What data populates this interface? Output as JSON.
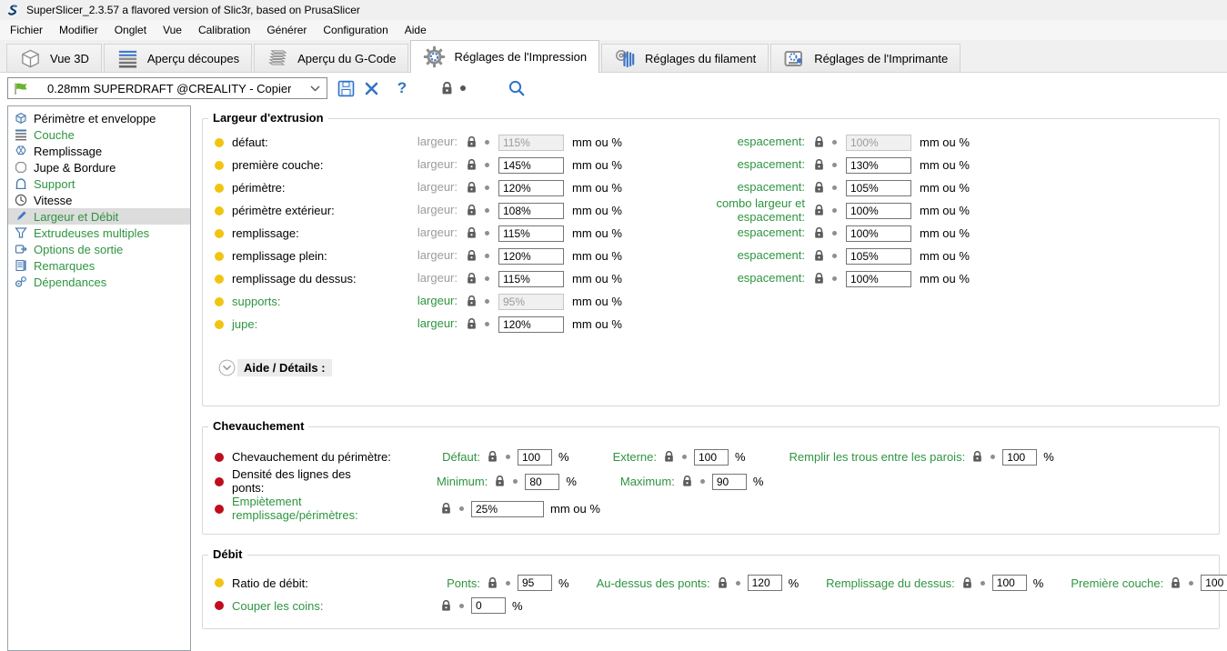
{
  "window": {
    "title": "SuperSlicer_2.3.57 a flavored version of Slic3r, based on PrusaSlicer"
  },
  "menu": {
    "items": [
      "Fichier",
      "Modifier",
      "Onglet",
      "Vue",
      "Calibration",
      "Générer",
      "Configuration",
      "Aide"
    ]
  },
  "tabs": [
    {
      "label": "Vue 3D",
      "icon": "view3d-icon",
      "active": false
    },
    {
      "label": "Aperçu découpes",
      "icon": "slices-icon",
      "active": false
    },
    {
      "label": "Aperçu du G-Code",
      "icon": "gcode-icon",
      "active": false
    },
    {
      "label": "Réglages de l'Impression",
      "icon": "print-settings-icon",
      "active": true
    },
    {
      "label": "Réglages du filament",
      "icon": "filament-settings-icon",
      "active": false
    },
    {
      "label": "Réglages de l'Imprimante",
      "icon": "printer-settings-icon",
      "active": false
    }
  ],
  "toolbar": {
    "preset": "0.28mm SUPERDRAFT @CREALITY - Copier",
    "help_glyph": "?",
    "icons": [
      "flag-icon",
      "save-icon",
      "delete-icon",
      "help-icon",
      "lock-icon",
      "search-icon"
    ]
  },
  "sidebar": {
    "items": [
      {
        "label": "Périmètre et enveloppe",
        "color": "black",
        "icon": "perimeter-icon",
        "selected": false
      },
      {
        "label": "Couche",
        "color": "green",
        "icon": "layers-icon",
        "selected": false
      },
      {
        "label": "Remplissage",
        "color": "black",
        "icon": "infill-icon",
        "selected": false
      },
      {
        "label": "Jupe & Bordure",
        "color": "black",
        "icon": "skirt-icon",
        "selected": false
      },
      {
        "label": "Support",
        "color": "green",
        "icon": "support-icon",
        "selected": false
      },
      {
        "label": "Vitesse",
        "color": "black",
        "icon": "speed-icon",
        "selected": false
      },
      {
        "label": "Largeur et Débit",
        "color": "green",
        "icon": "width-flow-icon",
        "selected": true
      },
      {
        "label": "Extrudeuses multiples",
        "color": "green",
        "icon": "extruders-icon",
        "selected": false
      },
      {
        "label": "Options de sortie",
        "color": "green",
        "icon": "output-icon",
        "selected": false
      },
      {
        "label": "Remarques",
        "color": "green",
        "icon": "notes-icon",
        "selected": false
      },
      {
        "label": "Dépendances",
        "color": "green",
        "icon": "dependencies-icon",
        "selected": false
      }
    ]
  },
  "sections": {
    "extrusion": {
      "title": "Largeur d'extrusion",
      "help_label": "Aide / Détails :",
      "unit": "mm ou %",
      "rows": [
        {
          "dot": "yellow",
          "label": "défaut:",
          "label_style": "black",
          "left": {
            "name": "largeur:",
            "style": "gray",
            "value": "115%",
            "disabled": true
          },
          "right": {
            "name": "espacement:",
            "style": "green",
            "value": "100%",
            "disabled": true
          }
        },
        {
          "dot": "yellow",
          "label": "première couche:",
          "label_style": "black",
          "left": {
            "name": "largeur:",
            "style": "gray",
            "value": "145%",
            "disabled": false
          },
          "right": {
            "name": "espacement:",
            "style": "green",
            "value": "130%",
            "disabled": false
          }
        },
        {
          "dot": "yellow",
          "label": "périmètre:",
          "label_style": "black",
          "left": {
            "name": "largeur:",
            "style": "gray",
            "value": "120%",
            "disabled": false
          },
          "right": {
            "name": "espacement:",
            "style": "green",
            "value": "105%",
            "disabled": false
          }
        },
        {
          "dot": "yellow",
          "label": "périmètre extérieur:",
          "label_style": "black",
          "left": {
            "name": "largeur:",
            "style": "gray",
            "value": "108%",
            "disabled": false
          },
          "right": {
            "name": "combo largeur et espacement:",
            "style": "green",
            "value": "100%",
            "disabled": false
          }
        },
        {
          "dot": "yellow",
          "label": "remplissage:",
          "label_style": "black",
          "left": {
            "name": "largeur:",
            "style": "gray",
            "value": "115%",
            "disabled": false
          },
          "right": {
            "name": "espacement:",
            "style": "green",
            "value": "100%",
            "disabled": false
          }
        },
        {
          "dot": "yellow",
          "label": "remplissage plein:",
          "label_style": "black",
          "left": {
            "name": "largeur:",
            "style": "gray",
            "value": "120%",
            "disabled": false
          },
          "right": {
            "name": "espacement:",
            "style": "green",
            "value": "105%",
            "disabled": false
          }
        },
        {
          "dot": "yellow",
          "label": "remplissage du dessus:",
          "label_style": "black",
          "left": {
            "name": "largeur:",
            "style": "gray",
            "value": "115%",
            "disabled": false
          },
          "right": {
            "name": "espacement:",
            "style": "green",
            "value": "100%",
            "disabled": false
          }
        },
        {
          "dot": "yellow",
          "label": "supports:",
          "label_style": "green",
          "left": {
            "name": "largeur:",
            "style": "green",
            "value": "95%",
            "disabled": true
          }
        },
        {
          "dot": "yellow",
          "label": "jupe:",
          "label_style": "green",
          "left": {
            "name": "largeur:",
            "style": "green",
            "value": "120%",
            "disabled": false
          }
        }
      ]
    },
    "overlap": {
      "title": "Chevauchement",
      "rows": [
        {
          "dot": "red",
          "label": "Chevauchement du périmètre:",
          "label_style": "black",
          "params": [
            {
              "name": "Défaut:",
              "value": "100",
              "suffix": "%",
              "wide": false
            },
            {
              "name": "Externe:",
              "value": "100",
              "suffix": "%",
              "wide": false
            },
            {
              "name": "Remplir les trous entre les parois:",
              "value": "100",
              "suffix": "%",
              "wide": false
            }
          ]
        },
        {
          "dot": "red",
          "label": "Densité des lignes des ponts:",
          "label_style": "black",
          "params": [
            {
              "name": "Minimum:",
              "value": "80",
              "suffix": "%",
              "wide": false
            },
            {
              "name": "Maximum:",
              "value": "90",
              "suffix": "%",
              "wide": false
            }
          ]
        },
        {
          "dot": "red",
          "label": "Empiètement remplissage/périmètres:",
          "label_style": "green",
          "params": [
            {
              "name": "",
              "value": "25%",
              "suffix": "mm ou %",
              "wide": true
            }
          ]
        }
      ]
    },
    "flow": {
      "title": "Débit",
      "rows": [
        {
          "dot": "yellow",
          "label": "Ratio de débit:",
          "label_style": "black",
          "params": [
            {
              "name": "Ponts:",
              "value": "95",
              "suffix": "%",
              "wide": false
            },
            {
              "name": "Au-dessus des ponts:",
              "value": "120",
              "suffix": "%",
              "wide": false
            },
            {
              "name": "Remplissage du dessus:",
              "value": "100",
              "suffix": "%",
              "wide": false
            },
            {
              "name": "Première couche:",
              "value": "100",
              "suffix": "%",
              "wide": false
            }
          ]
        },
        {
          "dot": "red",
          "label": "Couper les coins:",
          "label_style": "green",
          "params": [
            {
              "name": "",
              "value": "0",
              "suffix": "%",
              "wide": false
            }
          ]
        }
      ]
    }
  },
  "colors": {
    "accent_green": "#2e9440",
    "label_gray": "#9c9c9c",
    "dot_yellow": "#f1c40f",
    "dot_red": "#c00d1d",
    "icon_blue": "#2f74c9",
    "sidebar_icon_blue": "#4a7bb0"
  }
}
